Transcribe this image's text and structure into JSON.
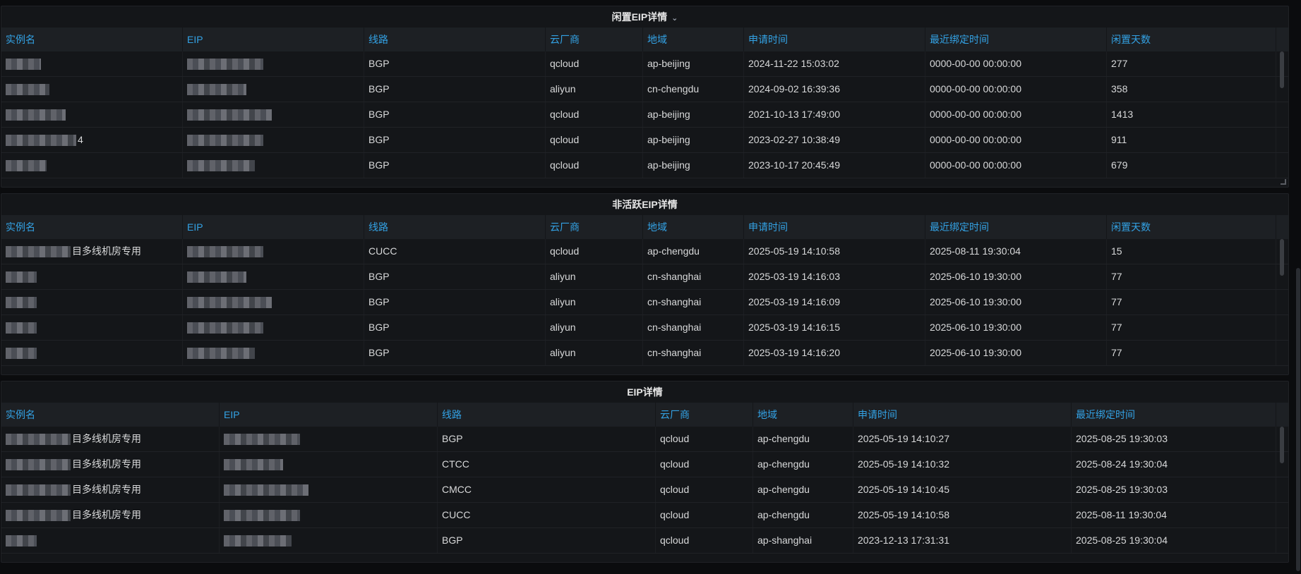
{
  "panels": [
    {
      "title": "闲置EIP详情",
      "has_caret": true,
      "columns": [
        "实例名",
        "EIP",
        "线路",
        "云厂商",
        "地域",
        "申请时间",
        "最近绑定时间",
        "闲置天数"
      ],
      "rows": [
        {
          "instance_suffix": "",
          "line": "BGP",
          "vendor": "qcloud",
          "region": "ap-beijing",
          "apply_time": "2024-11-22 15:03:02",
          "bind_time": "0000-00-00 00:00:00",
          "idle_days": "277"
        },
        {
          "instance_suffix": "",
          "line": "BGP",
          "vendor": "aliyun",
          "region": "cn-chengdu",
          "apply_time": "2024-09-02 16:39:36",
          "bind_time": "0000-00-00 00:00:00",
          "idle_days": "358"
        },
        {
          "instance_suffix": "",
          "line": "BGP",
          "vendor": "qcloud",
          "region": "ap-beijing",
          "apply_time": "2021-10-13 17:49:00",
          "bind_time": "0000-00-00 00:00:00",
          "idle_days": "1413"
        },
        {
          "instance_suffix": "4",
          "line": "BGP",
          "vendor": "qcloud",
          "region": "ap-beijing",
          "apply_time": "2023-02-27 10:38:49",
          "bind_time": "0000-00-00 00:00:00",
          "idle_days": "911"
        },
        {
          "instance_suffix": "",
          "line": "BGP",
          "vendor": "qcloud",
          "region": "ap-beijing",
          "apply_time": "2023-10-17 20:45:49",
          "bind_time": "0000-00-00 00:00:00",
          "idle_days": "679"
        }
      ]
    },
    {
      "title": "非活跃EIP详情",
      "has_caret": false,
      "columns": [
        "实例名",
        "EIP",
        "线路",
        "云厂商",
        "地域",
        "申请时间",
        "最近绑定时间",
        "闲置天数"
      ],
      "rows": [
        {
          "instance_suffix": "目多线机房专用",
          "line": "CUCC",
          "vendor": "qcloud",
          "region": "ap-chengdu",
          "apply_time": "2025-05-19 14:10:58",
          "bind_time": "2025-08-11 19:30:04",
          "idle_days": "15"
        },
        {
          "instance_suffix": "",
          "line": "BGP",
          "vendor": "aliyun",
          "region": "cn-shanghai",
          "apply_time": "2025-03-19 14:16:03",
          "bind_time": "2025-06-10 19:30:00",
          "idle_days": "77"
        },
        {
          "instance_suffix": "",
          "line": "BGP",
          "vendor": "aliyun",
          "region": "cn-shanghai",
          "apply_time": "2025-03-19 14:16:09",
          "bind_time": "2025-06-10 19:30:00",
          "idle_days": "77"
        },
        {
          "instance_suffix": "",
          "line": "BGP",
          "vendor": "aliyun",
          "region": "cn-shanghai",
          "apply_time": "2025-03-19 14:16:15",
          "bind_time": "2025-06-10 19:30:00",
          "idle_days": "77"
        },
        {
          "instance_suffix": "",
          "line": "BGP",
          "vendor": "aliyun",
          "region": "cn-shanghai",
          "apply_time": "2025-03-19 14:16:20",
          "bind_time": "2025-06-10 19:30:00",
          "idle_days": "77"
        }
      ]
    },
    {
      "title": "EIP详情",
      "has_caret": false,
      "columns": [
        "实例名",
        "EIP",
        "线路",
        "云厂商",
        "地域",
        "申请时间",
        "最近绑定时间"
      ],
      "rows": [
        {
          "instance_suffix": "目多线机房专用",
          "line": "BGP",
          "vendor": "qcloud",
          "region": "ap-chengdu",
          "apply_time": "2025-05-19 14:10:27",
          "bind_time": "2025-08-25 19:30:03"
        },
        {
          "instance_suffix": "目多线机房专用",
          "line": "CTCC",
          "vendor": "qcloud",
          "region": "ap-chengdu",
          "apply_time": "2025-05-19 14:10:32",
          "bind_time": "2025-08-24 19:30:04"
        },
        {
          "instance_suffix": "目多线机房专用",
          "line": "CMCC",
          "vendor": "qcloud",
          "region": "ap-chengdu",
          "apply_time": "2025-05-19 14:10:45",
          "bind_time": "2025-08-25 19:30:03"
        },
        {
          "instance_suffix": "目多线机房专用",
          "line": "CUCC",
          "vendor": "qcloud",
          "region": "ap-chengdu",
          "apply_time": "2025-05-19 14:10:58",
          "bind_time": "2025-08-11 19:30:04"
        },
        {
          "instance_suffix": "",
          "line": "BGP",
          "vendor": "qcloud",
          "region": "ap-shanghai",
          "apply_time": "2023-12-13 17:31:31",
          "bind_time": "2025-08-25 19:30:04"
        }
      ]
    }
  ],
  "icons": {
    "caret": "chevron-down-icon",
    "resize": "resize-handle-icon"
  },
  "colors": {
    "header_text": "#33a2e5",
    "panel_bg": "#141619",
    "header_bg": "#1d2024",
    "page_bg": "#0b0c0e"
  }
}
